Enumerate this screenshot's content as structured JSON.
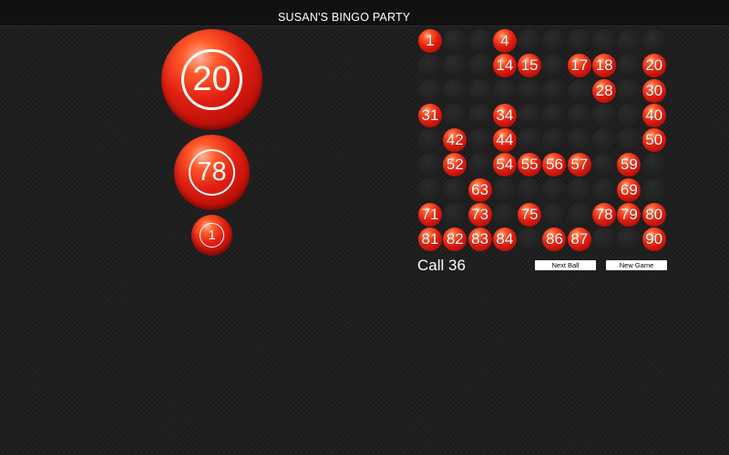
{
  "window": {
    "title": "SUSAN'S BINGO PARTY"
  },
  "recent_balls": {
    "current": "20",
    "previous_1": "78",
    "previous_2": "1"
  },
  "board": {
    "called": [
      1,
      4,
      14,
      15,
      17,
      18,
      20,
      28,
      30,
      31,
      34,
      40,
      42,
      44,
      50,
      52,
      54,
      55,
      56,
      57,
      59,
      63,
      69,
      71,
      73,
      75,
      78,
      79,
      80,
      81,
      82,
      83,
      84,
      86,
      87,
      90
    ]
  },
  "status": {
    "call_count": "Call 36"
  },
  "buttons": {
    "next_ball": "Next Ball",
    "new_game": "New Game"
  },
  "colors": {
    "ball_red": "#e11f12",
    "background": "#1f1f1f"
  }
}
